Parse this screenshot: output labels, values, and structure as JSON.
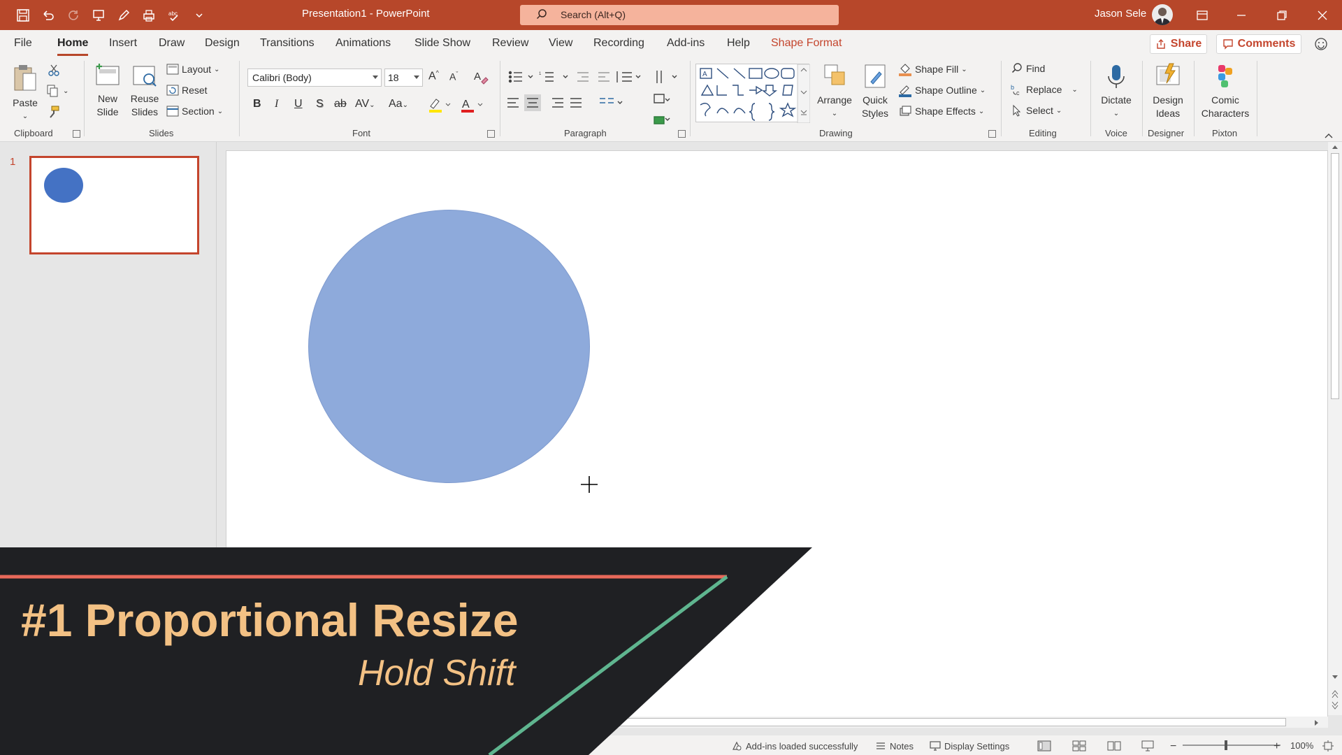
{
  "titlebar": {
    "doc_title": "Presentation1  -  PowerPoint",
    "search_placeholder": "Search (Alt+Q)",
    "user_name": "Jason Sele"
  },
  "tabs": [
    "File",
    "Home",
    "Insert",
    "Draw",
    "Design",
    "Transitions",
    "Animations",
    "Slide Show",
    "Review",
    "View",
    "Recording",
    "Add-ins",
    "Help",
    "Shape Format"
  ],
  "active_tab": "Home",
  "share_label": "Share",
  "comments_label": "Comments",
  "ribbon": {
    "clipboard": {
      "paste": "Paste",
      "label": "Clipboard"
    },
    "slides": {
      "new_slide_1": "New",
      "new_slide_2": "Slide",
      "reuse_1": "Reuse",
      "reuse_2": "Slides",
      "layout": "Layout",
      "reset": "Reset",
      "section": "Section",
      "label": "Slides"
    },
    "font": {
      "name": "Calibri (Body)",
      "size": "18",
      "label": "Font",
      "bold": "B",
      "italic": "I",
      "underline": "U",
      "shadow": "S",
      "strike": "ab",
      "spacing": "AV",
      "case": "Aa"
    },
    "paragraph": {
      "label": "Paragraph"
    },
    "drawing": {
      "arrange": "Arrange",
      "quick_1": "Quick",
      "quick_2": "Styles",
      "shape_fill": "Shape Fill",
      "shape_outline": "Shape Outline",
      "shape_effects": "Shape Effects",
      "label": "Drawing"
    },
    "editing": {
      "find": "Find",
      "replace": "Replace",
      "select": "Select",
      "label": "Editing"
    },
    "voice": {
      "dictate": "Dictate",
      "label": "Voice"
    },
    "designer": {
      "design_1": "Design",
      "design_2": "Ideas",
      "label": "Designer"
    },
    "pixton": {
      "comic_1": "Comic",
      "comic_2": "Characters",
      "label": "Pixton"
    }
  },
  "thumbnails": {
    "slide_number": "1"
  },
  "statusbar": {
    "addins": "Add-ins loaded successfully",
    "notes": "Notes",
    "display": "Display Settings",
    "zoom": "100%"
  },
  "overlay": {
    "title": "#1 Proportional Resize",
    "subtitle": "Hold Shift"
  },
  "colors": {
    "accent": "#b7472a",
    "shape_fill": "#8eaadb",
    "banner_bg": "#1f2023",
    "banner_text": "#f3c184",
    "banner_red_line": "#e8685a",
    "banner_green_line": "#5fb58f"
  }
}
